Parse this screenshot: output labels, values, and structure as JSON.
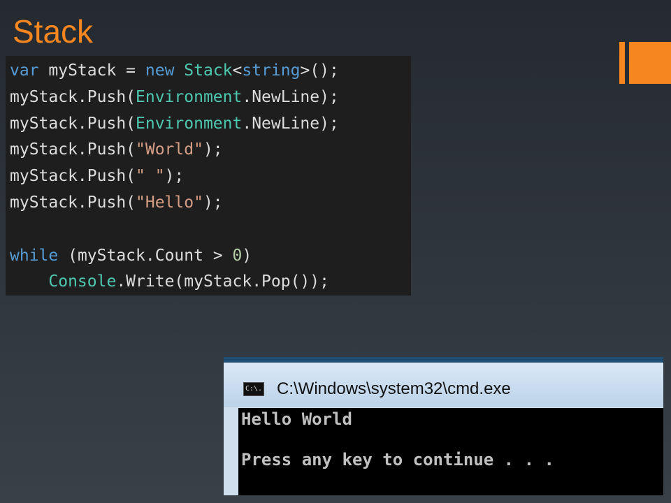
{
  "slide": {
    "title": "Stack"
  },
  "colors": {
    "accent": "#f6861f",
    "code_background": "#1e1e1e",
    "console_background": "#000000"
  },
  "code": {
    "lines": [
      [
        {
          "text": "var",
          "kind": "kw"
        },
        {
          "text": " myStack = ",
          "kind": "id"
        },
        {
          "text": "new",
          "kind": "kw"
        },
        {
          "text": " ",
          "kind": "id"
        },
        {
          "text": "Stack",
          "kind": "type"
        },
        {
          "text": "<",
          "kind": "punct"
        },
        {
          "text": "string",
          "kind": "kw"
        },
        {
          "text": ">();",
          "kind": "punct"
        }
      ],
      [
        {
          "text": "myStack.Push(",
          "kind": "id"
        },
        {
          "text": "Environment",
          "kind": "type"
        },
        {
          "text": ".NewLine);",
          "kind": "id"
        }
      ],
      [
        {
          "text": "myStack.Push(",
          "kind": "id"
        },
        {
          "text": "Environment",
          "kind": "type"
        },
        {
          "text": ".NewLine);",
          "kind": "id"
        }
      ],
      [
        {
          "text": "myStack.Push(",
          "kind": "id"
        },
        {
          "text": "\"World\"",
          "kind": "str"
        },
        {
          "text": ");",
          "kind": "id"
        }
      ],
      [
        {
          "text": "myStack.Push(",
          "kind": "id"
        },
        {
          "text": "\" \"",
          "kind": "str"
        },
        {
          "text": ");",
          "kind": "id"
        }
      ],
      [
        {
          "text": "myStack.Push(",
          "kind": "id"
        },
        {
          "text": "\"Hello\"",
          "kind": "str"
        },
        {
          "text": ");",
          "kind": "id"
        }
      ],
      [],
      [
        {
          "text": "while",
          "kind": "kw"
        },
        {
          "text": " (myStack.Count > ",
          "kind": "id"
        },
        {
          "text": "0",
          "kind": "num"
        },
        {
          "text": ")",
          "kind": "id"
        }
      ],
      [
        {
          "text": "    ",
          "kind": "id"
        },
        {
          "text": "Console",
          "kind": "type"
        },
        {
          "text": ".Write(myStack.Pop());",
          "kind": "id"
        }
      ]
    ]
  },
  "console": {
    "icon_label": "C:\\.",
    "title": "C:\\Windows\\system32\\cmd.exe",
    "lines": [
      "Hello World",
      "",
      "Press any key to continue . . ."
    ]
  }
}
